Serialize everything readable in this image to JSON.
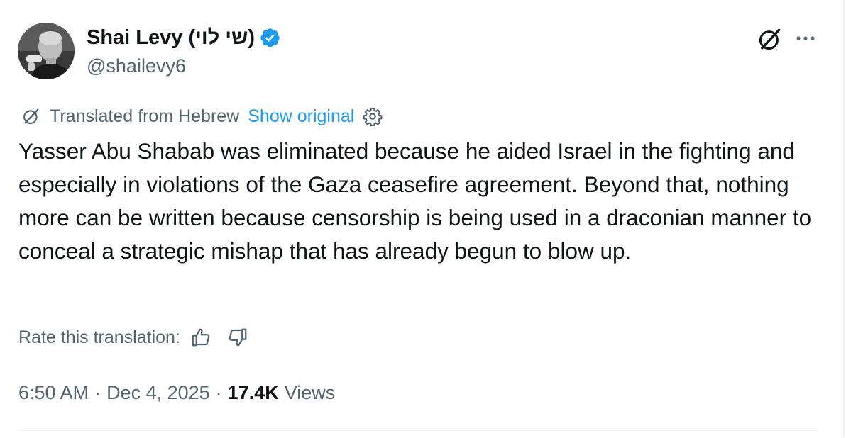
{
  "author": {
    "display_name": "Shai Levy (שי לוי)",
    "handle": "@shailevy6",
    "verified": true,
    "avatar_icon": "user-avatar-photo",
    "verified_color": "#1d9bf0"
  },
  "header_icons": {
    "grok": "grok-icon",
    "more": "more-icon"
  },
  "translation": {
    "label": "Translated from Hebrew",
    "show_original": "Show original",
    "settings_icon": "gear-icon"
  },
  "tweet": {
    "text": "Yasser Abu Shabab was eliminated because he aided Israel in the fighting and especially in violations of the Gaza ceasefire agreement. Beyond that, nothing more can be written because censorship is being used in a draconian manner to conceal a strategic mishap that has already begun to blow up."
  },
  "rating": {
    "label": "Rate this translation:",
    "thumbs_up_icon": "thumbs-up-icon",
    "thumbs_down_icon": "thumbs-down-icon"
  },
  "meta": {
    "time": "6:50 AM",
    "separator": "·",
    "date": "Dec 4, 2025",
    "views_count": "17.4K",
    "views_label": "Views"
  },
  "colors": {
    "text": "#0f1419",
    "secondary": "#536471",
    "accent": "#1d9bf0",
    "border": "#eff3f4"
  }
}
